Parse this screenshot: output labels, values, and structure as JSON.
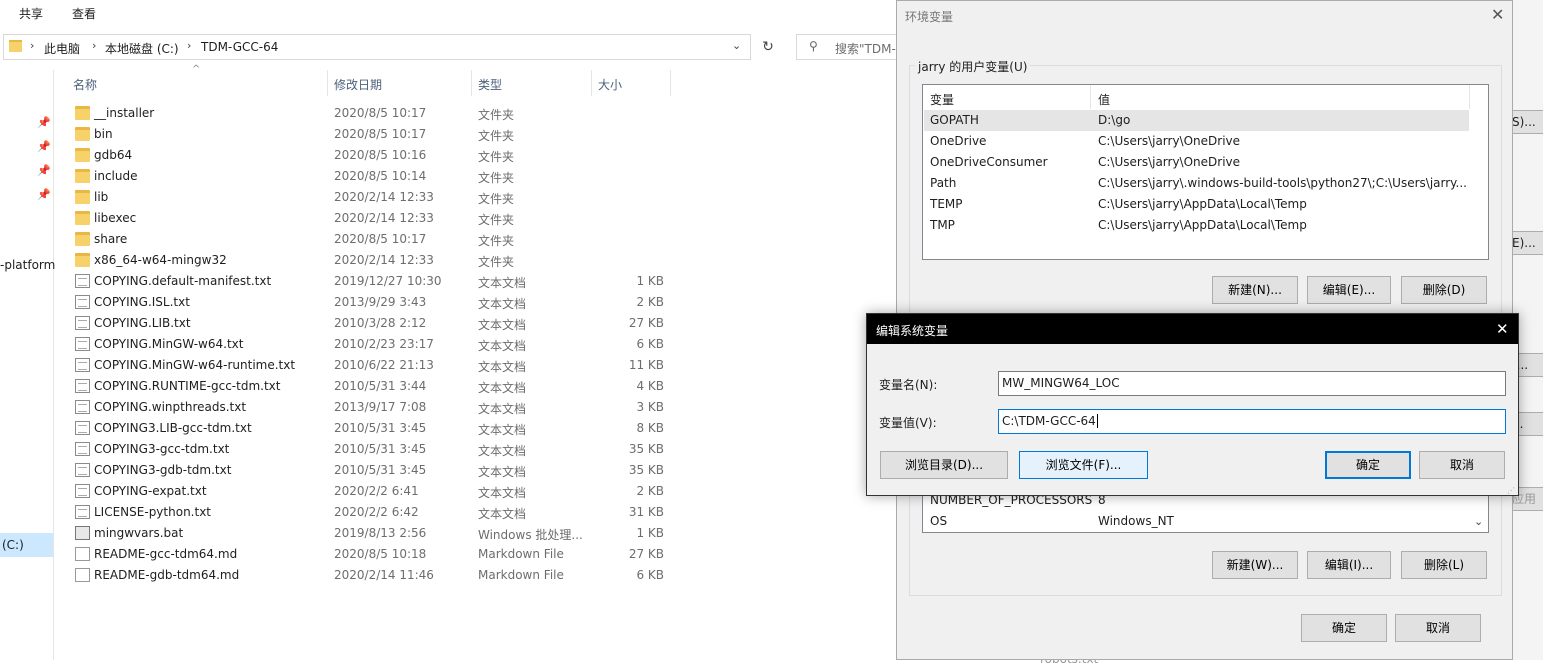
{
  "explorer": {
    "ribbon": [
      "共享",
      "查看"
    ],
    "breadcrumb": [
      "此电脑",
      "本地磁盘 (C:)",
      "TDM-GCC-64"
    ],
    "search_placeholder": "搜索\"TDM-",
    "nav_items": [
      "-platform",
      "(C:)"
    ],
    "columns": {
      "name": "名称",
      "date": "修改日期",
      "type": "类型",
      "size": "大小"
    },
    "files": [
      {
        "name": "__installer",
        "date": "2020/8/5 10:17",
        "type": "文件夹",
        "size": "",
        "kind": "folder"
      },
      {
        "name": "bin",
        "date": "2020/8/5 10:17",
        "type": "文件夹",
        "size": "",
        "kind": "folder"
      },
      {
        "name": "gdb64",
        "date": "2020/8/5 10:16",
        "type": "文件夹",
        "size": "",
        "kind": "folder"
      },
      {
        "name": "include",
        "date": "2020/8/5 10:14",
        "type": "文件夹",
        "size": "",
        "kind": "folder"
      },
      {
        "name": "lib",
        "date": "2020/2/14 12:33",
        "type": "文件夹",
        "size": "",
        "kind": "folder"
      },
      {
        "name": "libexec",
        "date": "2020/2/14 12:33",
        "type": "文件夹",
        "size": "",
        "kind": "folder"
      },
      {
        "name": "share",
        "date": "2020/8/5 10:17",
        "type": "文件夹",
        "size": "",
        "kind": "folder"
      },
      {
        "name": "x86_64-w64-mingw32",
        "date": "2020/2/14 12:33",
        "type": "文件夹",
        "size": "",
        "kind": "folder"
      },
      {
        "name": "COPYING.default-manifest.txt",
        "date": "2019/12/27 10:30",
        "type": "文本文档",
        "size": "1 KB",
        "kind": "txt"
      },
      {
        "name": "COPYING.ISL.txt",
        "date": "2013/9/29 3:43",
        "type": "文本文档",
        "size": "2 KB",
        "kind": "txt"
      },
      {
        "name": "COPYING.LIB.txt",
        "date": "2010/3/28 2:12",
        "type": "文本文档",
        "size": "27 KB",
        "kind": "txt"
      },
      {
        "name": "COPYING.MinGW-w64.txt",
        "date": "2010/2/23 23:17",
        "type": "文本文档",
        "size": "6 KB",
        "kind": "txt"
      },
      {
        "name": "COPYING.MinGW-w64-runtime.txt",
        "date": "2010/6/22 21:13",
        "type": "文本文档",
        "size": "11 KB",
        "kind": "txt"
      },
      {
        "name": "COPYING.RUNTIME-gcc-tdm.txt",
        "date": "2010/5/31 3:44",
        "type": "文本文档",
        "size": "4 KB",
        "kind": "txt"
      },
      {
        "name": "COPYING.winpthreads.txt",
        "date": "2013/9/17 7:08",
        "type": "文本文档",
        "size": "3 KB",
        "kind": "txt"
      },
      {
        "name": "COPYING3.LIB-gcc-tdm.txt",
        "date": "2010/5/31 3:45",
        "type": "文本文档",
        "size": "8 KB",
        "kind": "txt"
      },
      {
        "name": "COPYING3-gcc-tdm.txt",
        "date": "2010/5/31 3:45",
        "type": "文本文档",
        "size": "35 KB",
        "kind": "txt"
      },
      {
        "name": "COPYING3-gdb-tdm.txt",
        "date": "2010/5/31 3:45",
        "type": "文本文档",
        "size": "35 KB",
        "kind": "txt"
      },
      {
        "name": "COPYING-expat.txt",
        "date": "2020/2/2 6:41",
        "type": "文本文档",
        "size": "2 KB",
        "kind": "txt"
      },
      {
        "name": "LICENSE-python.txt",
        "date": "2020/2/2 6:42",
        "type": "文本文档",
        "size": "31 KB",
        "kind": "txt"
      },
      {
        "name": "mingwvars.bat",
        "date": "2019/8/13 2:56",
        "type": "Windows 批处理...",
        "size": "1 KB",
        "kind": "bat"
      },
      {
        "name": "README-gcc-tdm64.md",
        "date": "2020/8/5 10:18",
        "type": "Markdown File",
        "size": "27 KB",
        "kind": "md"
      },
      {
        "name": "README-gdb-tdm64.md",
        "date": "2020/2/14 11:46",
        "type": "Markdown File",
        "size": "6 KB",
        "kind": "md"
      }
    ]
  },
  "env_dialog": {
    "title": "环境变量",
    "user_group_label": "jarry 的用户变量(U)",
    "user_columns": {
      "var": "变量",
      "val": "值"
    },
    "user_vars": [
      {
        "name": "GOPATH",
        "value": "D:\\go"
      },
      {
        "name": "OneDrive",
        "value": "C:\\Users\\jarry\\OneDrive"
      },
      {
        "name": "OneDriveConsumer",
        "value": "C:\\Users\\jarry\\OneDrive"
      },
      {
        "name": "Path",
        "value": "C:\\Users\\jarry\\.windows-build-tools\\python27\\;C:\\Users\\jarry..."
      },
      {
        "name": "TEMP",
        "value": "C:\\Users\\jarry\\AppData\\Local\\Temp"
      },
      {
        "name": "TMP",
        "value": "C:\\Users\\jarry\\AppData\\Local\\Temp"
      }
    ],
    "user_buttons": {
      "new": "新建(N)...",
      "edit": "编辑(E)...",
      "delete": "删除(D)"
    },
    "sys_vars": [
      {
        "name": "NUMBER_OF_PROCESSORS",
        "value": "8"
      },
      {
        "name": "OS",
        "value": "Windows_NT"
      }
    ],
    "sys_buttons": {
      "new": "新建(W)...",
      "edit": "编辑(I)...",
      "delete": "删除(L)"
    },
    "ok": "确定",
    "cancel": "取消"
  },
  "edit_dialog": {
    "title": "编辑系统变量",
    "name_label": "变量名(N):",
    "name_value": "MW_MINGW64_LOC",
    "value_label": "变量值(V):",
    "value_value": "C:\\TDM-GCC-64",
    "browse_dir": "浏览目录(D)...",
    "browse_file": "浏览文件(F)...",
    "ok": "确定",
    "cancel": "取消"
  },
  "background_window": {
    "buttons": [
      "S)...",
      "E)...",
      ")...",
      "...",
      "应用"
    ],
    "partial_text": "robots.txt"
  }
}
